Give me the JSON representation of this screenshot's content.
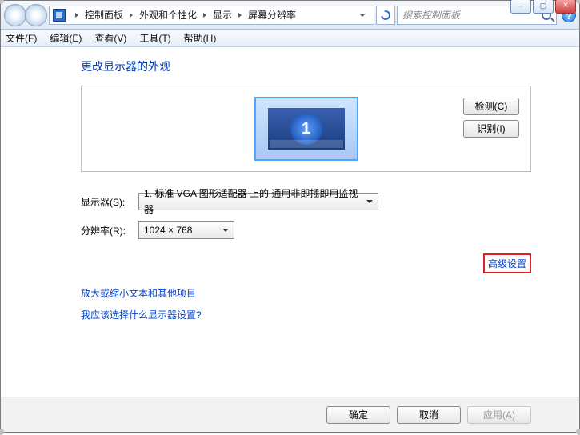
{
  "chrome": {
    "minimize": "–",
    "maximize": "▢",
    "close": "×"
  },
  "breadcrumb": {
    "items": [
      "控制面板",
      "外观和个性化",
      "显示",
      "屏幕分辨率"
    ]
  },
  "search": {
    "placeholder": "搜索控制面板"
  },
  "help": {
    "symbol": "?"
  },
  "menu": {
    "file": "文件(F)",
    "edit": "编辑(E)",
    "view": "查看(V)",
    "tools": "工具(T)",
    "help": "帮助(H)"
  },
  "page": {
    "title": "更改显示器的外观",
    "detect": "检测(C)",
    "identify": "识别(I)",
    "display_number": "1",
    "display_label": "显示器(S):",
    "display_value": "1. 标准 VGA 图形适配器 上的 通用非即插即用监视器",
    "resolution_label": "分辨率(R):",
    "resolution_value": "1024 × 768",
    "advanced_link": "高级设置",
    "link_textsize": "放大或缩小文本和其他项目",
    "link_whichsettings": "我应该选择什么显示器设置?",
    "ok": "确定",
    "cancel": "取消",
    "apply": "应用(A)"
  }
}
